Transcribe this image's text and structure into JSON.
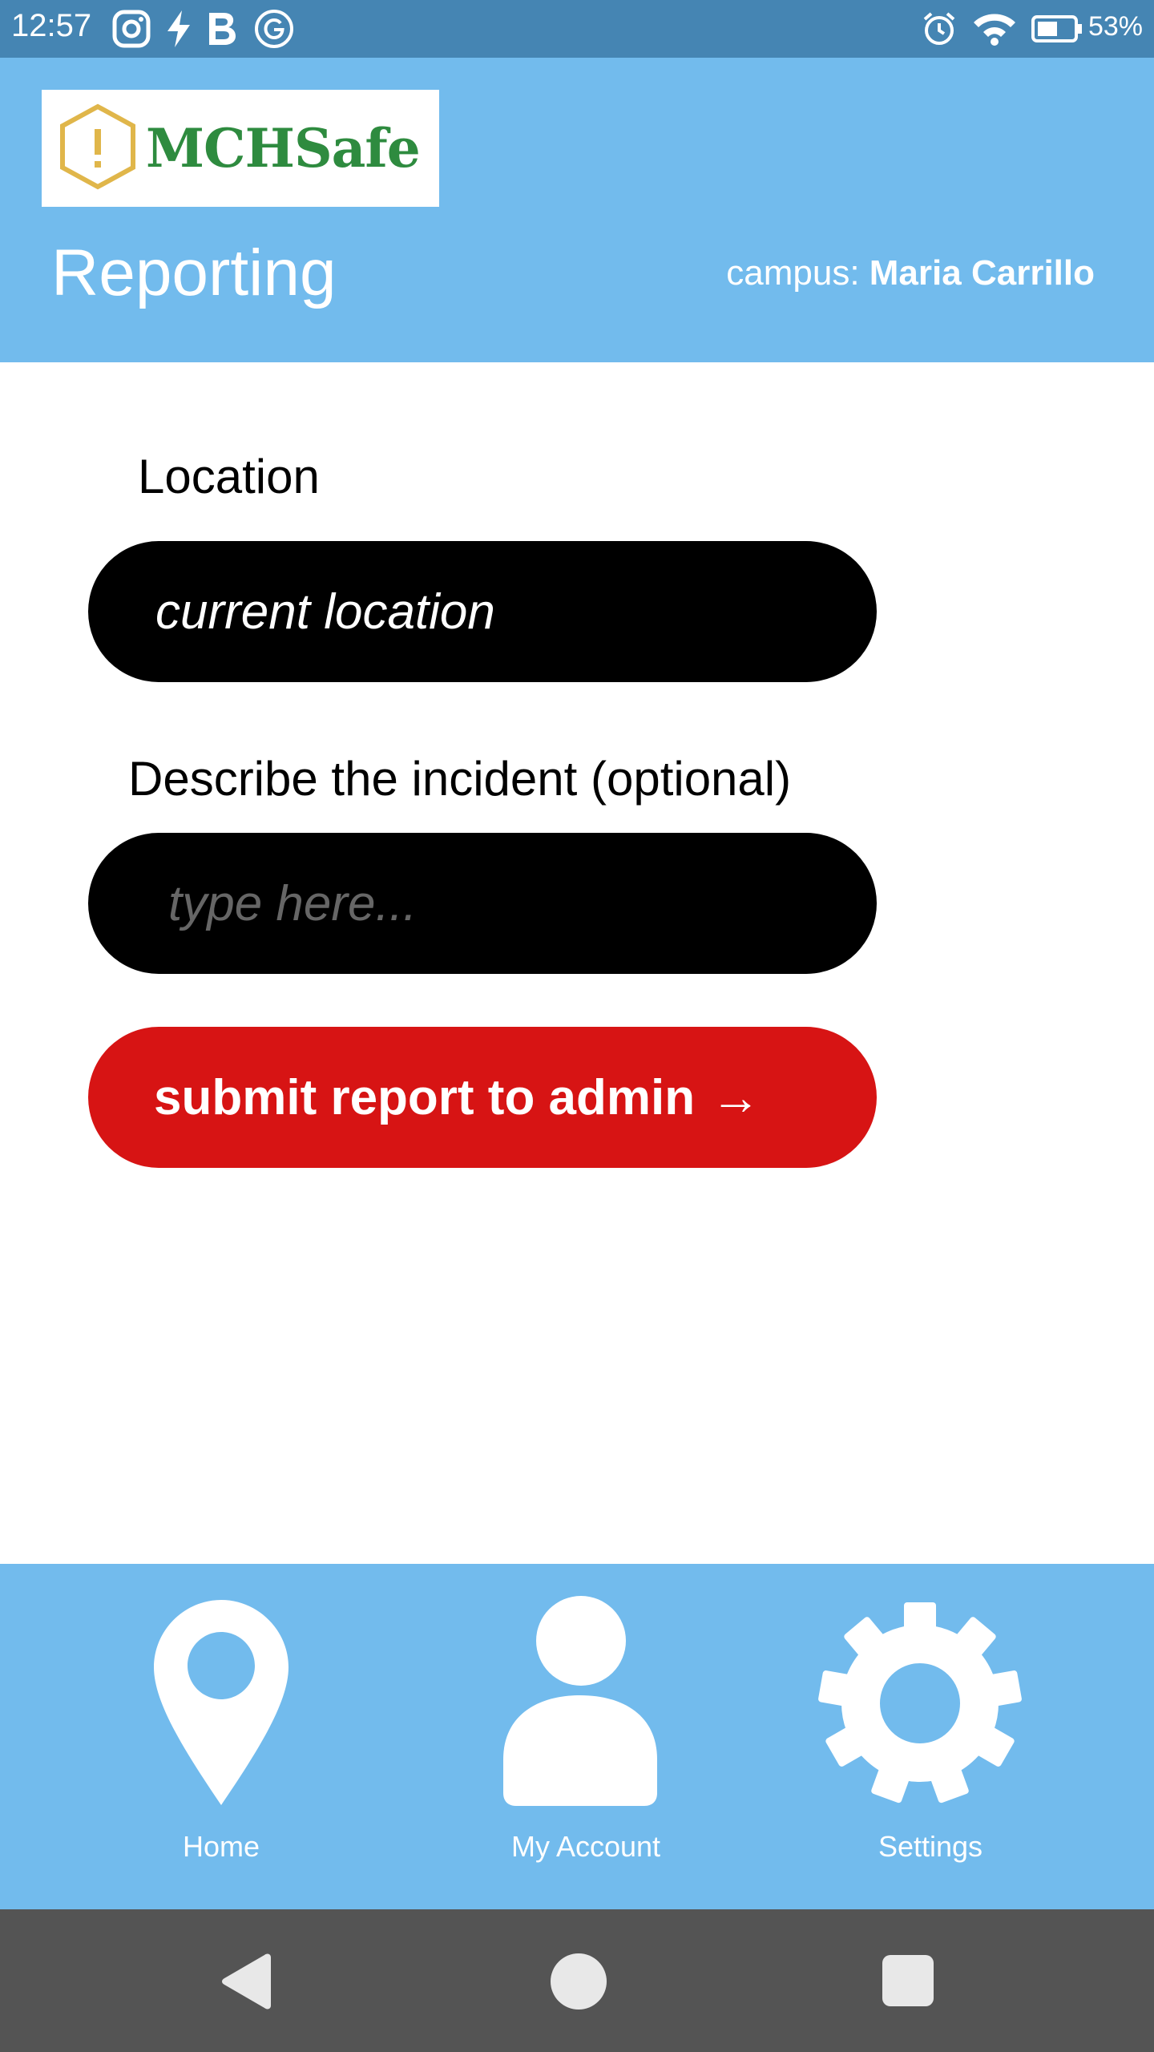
{
  "status_bar": {
    "time": "12:57",
    "battery": "53%",
    "left_icons": [
      "instagram-icon",
      "flash-icon",
      "b-letter-icon",
      "google-icon"
    ],
    "right_icons": [
      "alarm-icon",
      "wifi-icon",
      "battery-icon"
    ]
  },
  "header": {
    "logo_text": "MCHSafe",
    "title": "Reporting",
    "campus_label": "campus:",
    "campus_name": "Maria Carrillo"
  },
  "form": {
    "location_label": "Location",
    "location_value": "current location",
    "description_label": "Describe the incident (optional)",
    "description_placeholder": "type here...",
    "submit_label": "submit report to admin",
    "submit_arrow": "→"
  },
  "bottom_nav": {
    "items": [
      {
        "label": "Home",
        "icon": "location-pin-icon"
      },
      {
        "label": "My Account",
        "icon": "person-icon"
      },
      {
        "label": "Settings",
        "icon": "gear-icon"
      }
    ]
  },
  "system_nav": {
    "icons": [
      "back-icon",
      "home-circle-icon",
      "recents-icon"
    ]
  },
  "colors": {
    "status_bar": "#4585b3",
    "header": "#72bbed",
    "submit": "#d71414",
    "system_nav": "#545454",
    "logo_text": "#2e8b3f",
    "logo_hex": "#e0b64a"
  }
}
